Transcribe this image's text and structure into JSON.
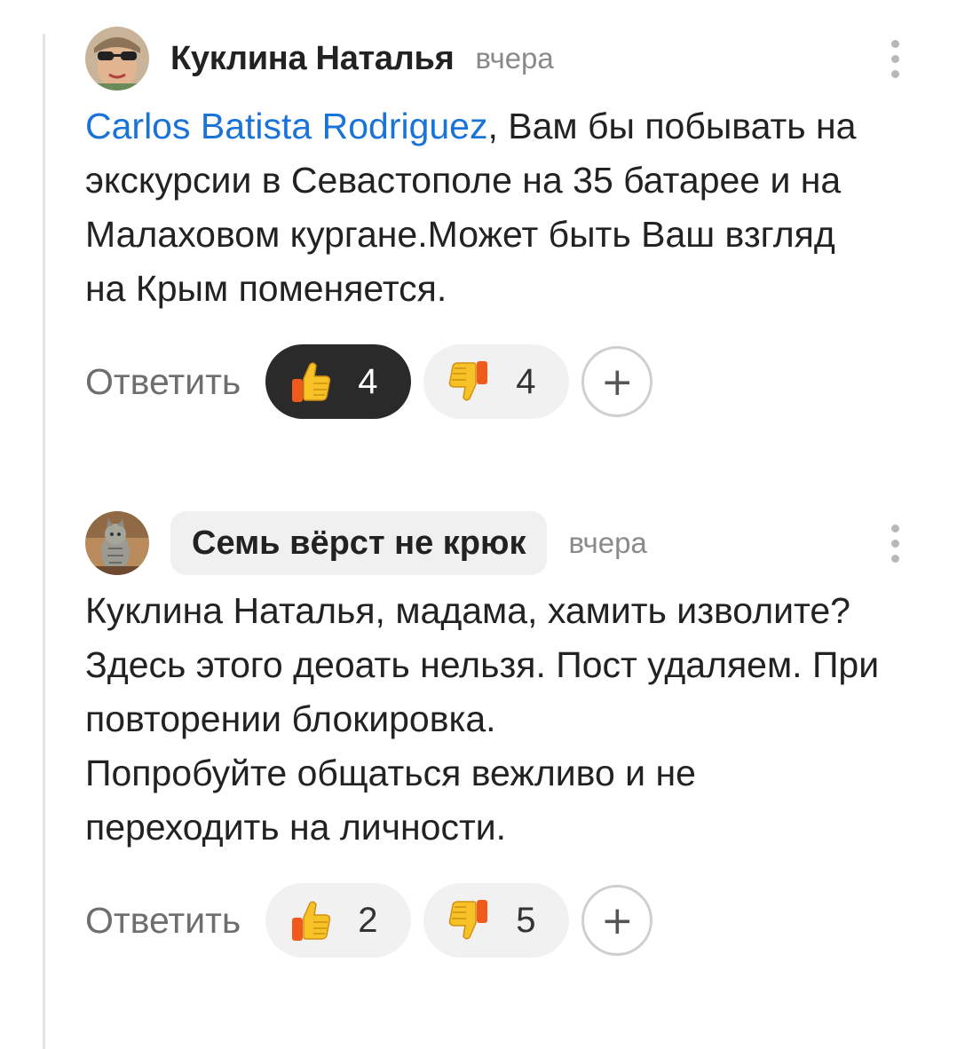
{
  "comments": [
    {
      "author": "Куклина Наталья",
      "time": "вчера",
      "mention": "Carlos Batista Rodriguez",
      "text": ", Вам бы побывать на экскурсии в Севастополе на 35 батарее и на Малаховом кургане.Может быть Ваш взгляд на Крым поменяется.",
      "reply_label": "Ответить",
      "likes": "4",
      "dislikes": "4",
      "add_reaction": "+",
      "like_active": true
    },
    {
      "author": "Семь вёрст не крюк",
      "time": "вчера",
      "text": "Куклина Наталья, мадама, хамить изволите? Здесь этого деоать нельзя. Пост удаляем. При повторении блокировка.\nПопробуйте общаться вежливо и не переходить на личности.",
      "reply_label": "Ответить",
      "likes": "2",
      "dislikes": "5",
      "add_reaction": "+",
      "like_active": false
    }
  ],
  "icons": {
    "like": "thumbs-up-icon",
    "dislike": "thumbs-down-icon",
    "menu": "more-vertical-icon"
  },
  "colors": {
    "mention": "#1a73d9",
    "active_vote_bg": "#2a2a2a",
    "chip_bg": "#f0f0f0"
  }
}
